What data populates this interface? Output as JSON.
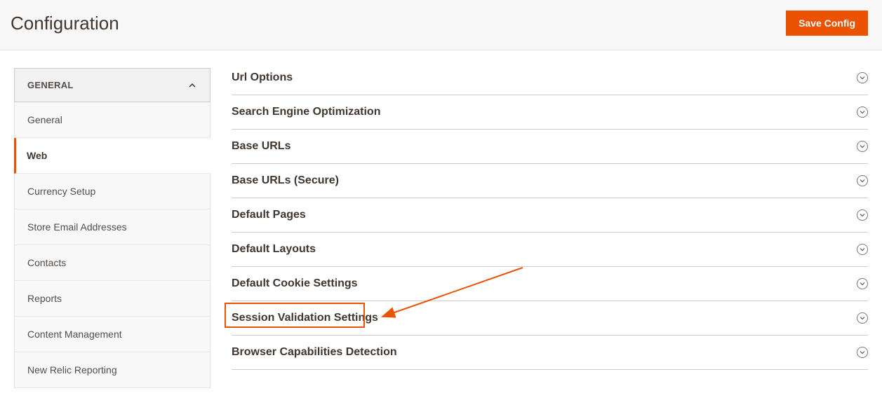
{
  "header": {
    "title": "Configuration",
    "save_label": "Save Config"
  },
  "sidebar": {
    "group_title": "GENERAL",
    "items": [
      {
        "label": "General",
        "active": false
      },
      {
        "label": "Web",
        "active": true
      },
      {
        "label": "Currency Setup",
        "active": false
      },
      {
        "label": "Store Email Addresses",
        "active": false
      },
      {
        "label": "Contacts",
        "active": false
      },
      {
        "label": "Reports",
        "active": false
      },
      {
        "label": "Content Management",
        "active": false
      },
      {
        "label": "New Relic Reporting",
        "active": false
      }
    ]
  },
  "sections": [
    {
      "label": "Url Options"
    },
    {
      "label": "Search Engine Optimization"
    },
    {
      "label": "Base URLs"
    },
    {
      "label": "Base URLs (Secure)"
    },
    {
      "label": "Default Pages"
    },
    {
      "label": "Default Layouts"
    },
    {
      "label": "Default Cookie Settings"
    },
    {
      "label": "Session Validation Settings"
    },
    {
      "label": "Browser Capabilities Detection"
    }
  ],
  "annotation": {
    "highlight_section_index": 6
  }
}
